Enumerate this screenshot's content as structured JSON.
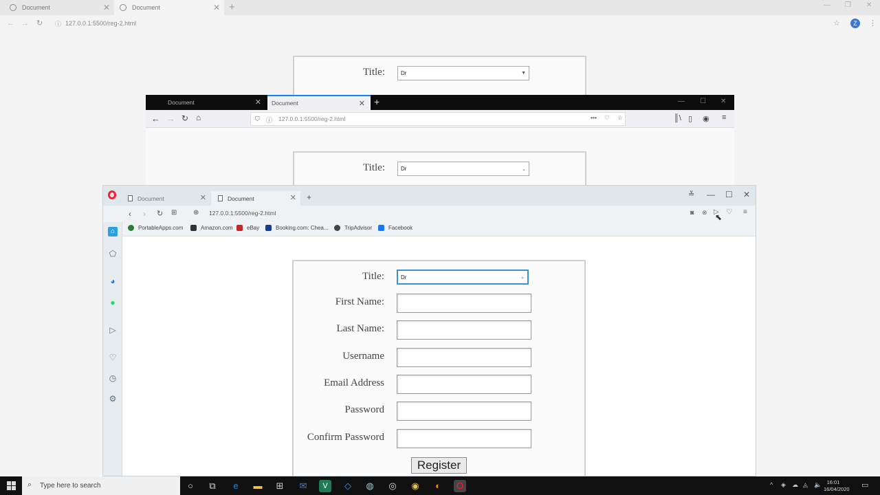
{
  "chrome": {
    "tabs": [
      {
        "label": "Document"
      },
      {
        "label": "Document"
      }
    ],
    "url": "127.0.0.1:5500/reg-2.html",
    "form": {
      "title_label": "Title:",
      "title_value": "Dr"
    }
  },
  "firefox": {
    "tabs": [
      {
        "label": "Document"
      },
      {
        "label": "Document"
      }
    ],
    "url": "127.0.0.1:5500/reg-2.html",
    "form": {
      "title_label": "Title:",
      "title_value": "Dr"
    }
  },
  "opera": {
    "tabs": [
      {
        "label": "Document"
      },
      {
        "label": "Document"
      }
    ],
    "url": "127.0.0.1:5500/reg-2.html",
    "bookmarks": [
      {
        "label": "PortableApps.com",
        "color": "#2e7d32"
      },
      {
        "label": "Amazon.com",
        "color": "#333333"
      },
      {
        "label": "eBay",
        "color": "#c62828"
      },
      {
        "label": "Booking.com: Chea...",
        "color": "#1a3c8c"
      },
      {
        "label": "TripAdvisor",
        "color": "#444444"
      },
      {
        "label": "Facebook",
        "color": "#1877f2"
      }
    ],
    "form": {
      "title_label": "Title:",
      "title_value": "Dr",
      "first_name_label": "First Name:",
      "last_name_label": "Last Name:",
      "username_label": "Username",
      "email_label": "Email Address",
      "password_label": "Password",
      "confirm_password_label": "Confirm Password",
      "register_label": "Register"
    }
  },
  "taskbar": {
    "search_placeholder": "Type here to search",
    "time": "16:01",
    "date": "16/04/2020"
  },
  "colors": {
    "opera_red": "#ff1b2d",
    "firefox_tabbar": "#0c0c0d",
    "firefox_accent": "#0a84ff",
    "focus_outline": "#3b8ed8"
  }
}
